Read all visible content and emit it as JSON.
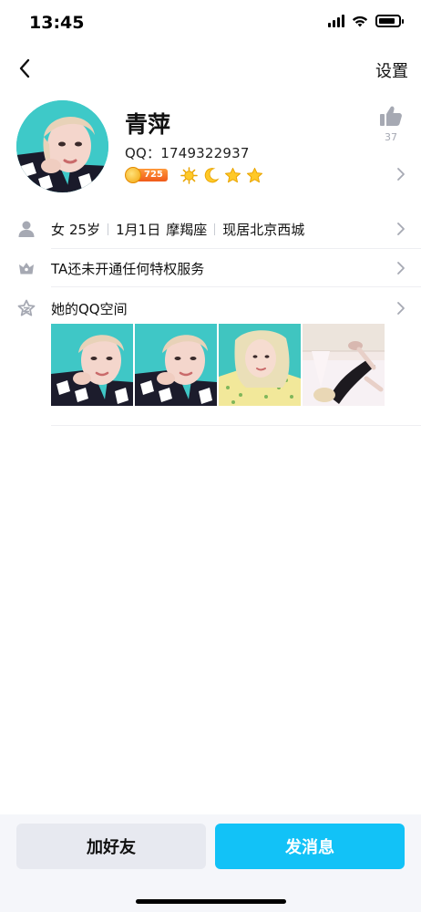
{
  "status_bar": {
    "time": "13:45",
    "signal_icon": "signal-icon",
    "wifi_icon": "wifi-icon",
    "battery_icon": "battery-icon"
  },
  "nav": {
    "back_icon": "back-arrow-icon",
    "settings_label": "设置"
  },
  "profile": {
    "nickname": "青萍",
    "qq_label": "QQ：1749322937",
    "vip_level": "725",
    "level_icons": [
      "sun-icon",
      "moon-icon",
      "star-icon",
      "star-icon"
    ],
    "like_count": "37",
    "like_icon": "thumbs-up-icon"
  },
  "info": {
    "gender": "女",
    "age": "25岁",
    "birthday": "1月1日",
    "zodiac": "摩羯座",
    "location": "现居北京西城",
    "privilege_text": "TA还未开通任何特权服务",
    "qzone_title": "她的QQ空间"
  },
  "qzone_photos": [
    {
      "name": "qzone-photo-1"
    },
    {
      "name": "qzone-photo-2"
    },
    {
      "name": "qzone-photo-3"
    },
    {
      "name": "qzone-photo-4"
    }
  ],
  "actions": {
    "add_friend": "加好友",
    "send_message": "发消息"
  },
  "colors": {
    "accent": "#12c2f7",
    "secondary_button": "#e7e9f0",
    "icon_gray": "#a6a9b3"
  }
}
